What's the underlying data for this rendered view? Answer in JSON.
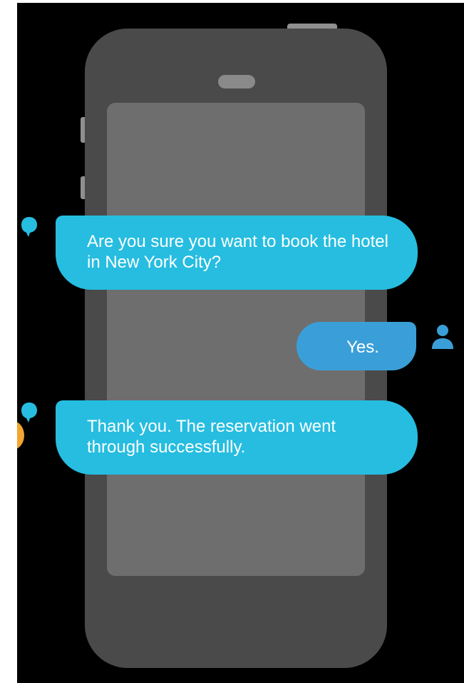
{
  "conversation": {
    "messages": [
      {
        "sender": "bot",
        "text": "Are you sure you want to book the hotel in New York City?"
      },
      {
        "sender": "user",
        "text": "Yes."
      },
      {
        "sender": "bot",
        "text": "Thank you. The reservation went through successfully."
      }
    ]
  },
  "icons": {
    "bot": "chat-bubble-icon",
    "user": "user-icon"
  },
  "colors": {
    "bot_bubble": "#26bde0",
    "user_bubble": "#3a9fd8",
    "phone_body": "#4a4a4a",
    "phone_screen": "#6e6e6e",
    "background": "#000000",
    "accent_orange": "#f2a531"
  }
}
